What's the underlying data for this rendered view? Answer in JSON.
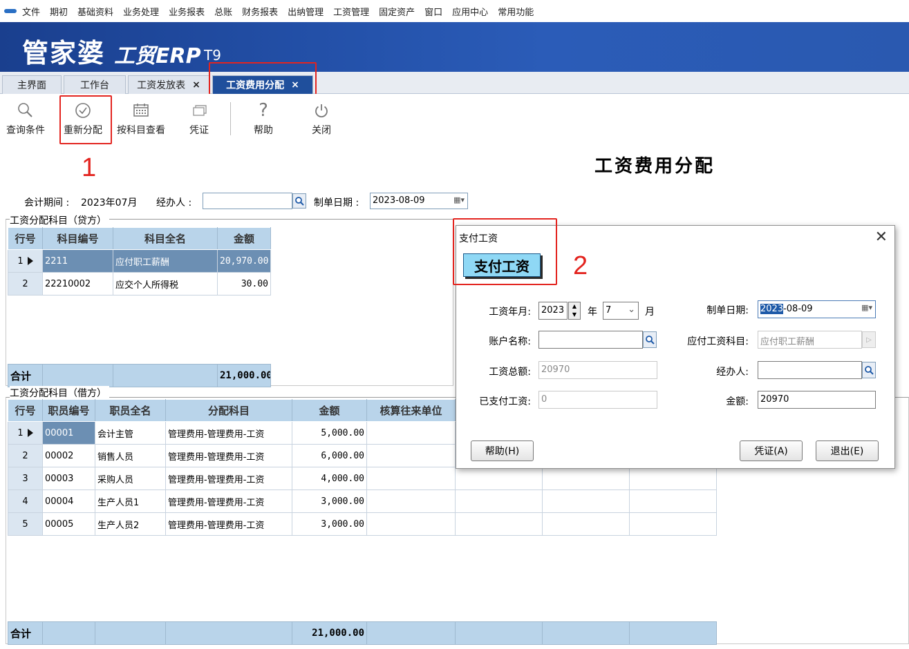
{
  "menu": [
    "文件",
    "期初",
    "基础资料",
    "业务处理",
    "业务报表",
    "总账",
    "财务报表",
    "出纳管理",
    "工资管理",
    "固定资产",
    "窗口",
    "应用中心",
    "常用功能"
  ],
  "brand": {
    "main": "管家婆",
    "sub": "工贸ERP",
    "version": "T9"
  },
  "tabs": [
    {
      "label": "主界面"
    },
    {
      "label": "工作台"
    },
    {
      "label": "工资发放表",
      "close": "×"
    },
    {
      "label": "工资费用分配",
      "close": "×"
    }
  ],
  "toolbar": [
    {
      "label": "查询条件",
      "icon": "search-icon"
    },
    {
      "label": "重新分配",
      "icon": "check-circle-icon"
    },
    {
      "label": "按科目查看",
      "icon": "calendar-grid-icon"
    },
    {
      "label": "凭证",
      "icon": "voucher-icon"
    },
    {
      "label": "帮助",
      "icon": "question-icon"
    },
    {
      "label": "关闭",
      "icon": "power-icon"
    }
  ],
  "annotations": {
    "one": "1",
    "two": "2"
  },
  "page_title": "工资费用分配",
  "filter": {
    "period_label": "会计期间 :",
    "period_value": "2023年07月",
    "handler_label": "经办人 :",
    "handler_value": "",
    "date_label": "制单日期 :",
    "date_value": "2023-08-09"
  },
  "credit": {
    "legend": "工资分配科目（贷方）",
    "headers": [
      "行号",
      "科目编号",
      "科目全名",
      "金额"
    ],
    "rows": [
      {
        "no": "1",
        "code": "2211",
        "name": "应付职工薪酬",
        "amount": "20,970.00"
      },
      {
        "no": "2",
        "code": "22210002",
        "name": "应交个人所得税",
        "amount": "30.00"
      }
    ],
    "total_label": "合计",
    "total_amount": "21,000.00"
  },
  "debit": {
    "legend": "工资分配科目（借方）",
    "headers": [
      "行号",
      "职员编号",
      "职员全名",
      "分配科目",
      "金额",
      "核算往来单位"
    ],
    "rows": [
      {
        "no": "1",
        "code": "00001",
        "name": "会计主管",
        "subject": "管理费用-管理费用-工资",
        "amount": "5,000.00"
      },
      {
        "no": "2",
        "code": "00002",
        "name": "销售人员",
        "subject": "管理费用-管理费用-工资",
        "amount": "6,000.00"
      },
      {
        "no": "3",
        "code": "00003",
        "name": "采购人员",
        "subject": "管理费用-管理费用-工资",
        "amount": "4,000.00"
      },
      {
        "no": "4",
        "code": "00004",
        "name": "生产人员1",
        "subject": "管理费用-管理费用-工资",
        "amount": "3,000.00"
      },
      {
        "no": "5",
        "code": "00005",
        "name": "生产人员2",
        "subject": "管理费用-管理费用-工资",
        "amount": "3,000.00"
      }
    ],
    "total_label": "合计",
    "total_amount": "21,000.00"
  },
  "dialog": {
    "title": "支付工资",
    "close": "✕",
    "header": "支付工资",
    "year_month_label": "工资年月:",
    "year_value": "2023",
    "year_unit": "年",
    "month_value": "7",
    "month_unit": "月",
    "date_label": "制单日期:",
    "date_value_highlight": "2023",
    "date_value_rest": "-08-09",
    "account_label": "账户名称:",
    "account_value": "",
    "payable_label": "应付工资科目:",
    "payable_value": "应付职工薪酬",
    "total_label": "工资总额:",
    "total_value": "20970",
    "handler_label": "经办人:",
    "handler_value": "",
    "paid_label": "已支付工资:",
    "paid_value": "0",
    "amount_label": "金额:",
    "amount_value": "20970",
    "help_btn": "帮助(H)",
    "voucher_btn": "凭证(A)",
    "exit_btn": "退出(E)"
  }
}
